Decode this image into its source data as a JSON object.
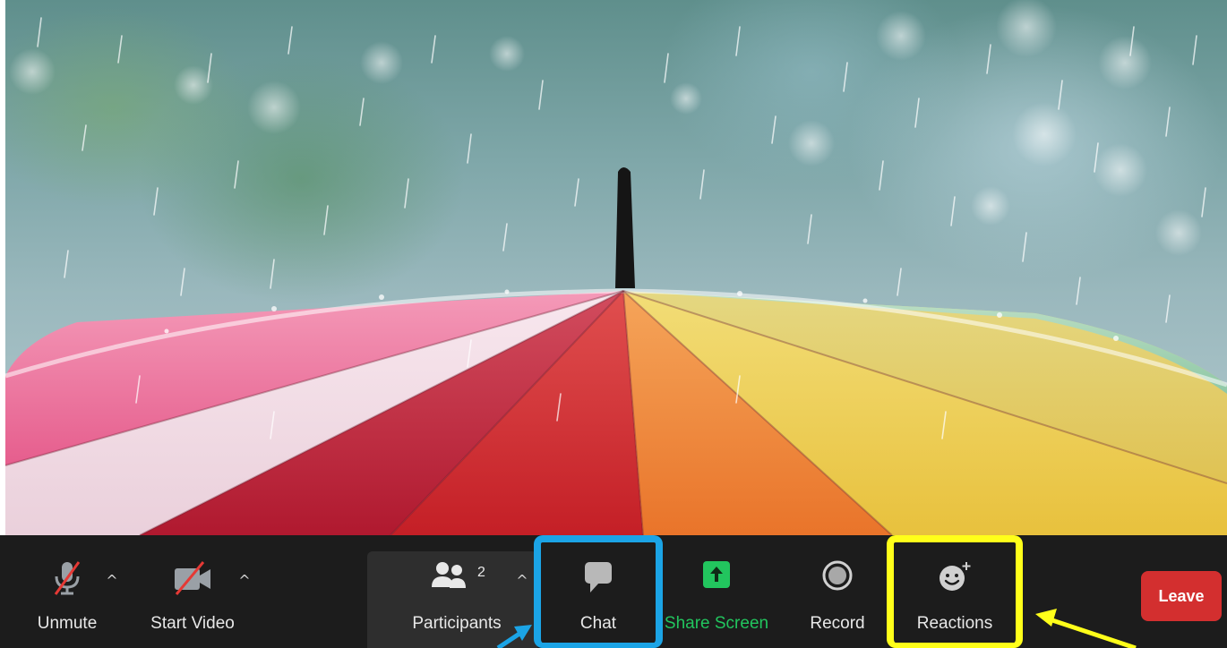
{
  "toolbar": {
    "unmute_label": "Unmute",
    "start_video_label": "Start Video",
    "participants_label": "Participants",
    "participants_count": "2",
    "chat_label": "Chat",
    "share_screen_label": "Share Screen",
    "record_label": "Record",
    "reactions_label": "Reactions",
    "leave_label": "Leave",
    "caret_glyph": "^"
  },
  "colors": {
    "toolbar_bg": "#1c1c1c",
    "share_screen_accent": "#22c55e",
    "leave_button": "#d32f2f",
    "chat_highlight": "#1ba4e6",
    "reactions_highlight": "#ffff1a",
    "muted_slash": "#e53935"
  },
  "icons": {
    "unmute": "muted-microphone-icon",
    "start_video": "video-off-camera-icon",
    "participants": "people-icon",
    "chat": "speech-bubble-icon",
    "share_screen": "up-arrow-share-icon",
    "record": "record-circle-icon",
    "reactions": "smiley-plus-icon"
  },
  "annotations": {
    "chat_highlight_color": "#1ba4e6",
    "reactions_highlight_color": "#ffff1a"
  }
}
